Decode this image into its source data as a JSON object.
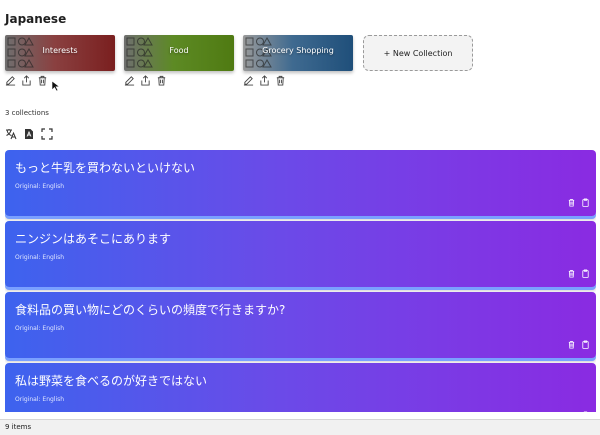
{
  "page": {
    "title": "Japanese"
  },
  "collections": [
    {
      "name": "Interests",
      "color": "#7a1f1f"
    },
    {
      "name": "Food",
      "color": "#4f7a12"
    },
    {
      "name": "Grocery Shopping",
      "color": "#1f4f7a"
    }
  ],
  "new_collection_label": "+ New Collection",
  "collections_count": "3 collections",
  "toolbar_icons": [
    "translate-icon",
    "pdf-icon",
    "fullscreen-icon"
  ],
  "phrases": [
    {
      "text": "もっと牛乳を買わないといけない",
      "original": "Original: English"
    },
    {
      "text": "ニンジンはあそこにあります",
      "original": "Original: English"
    },
    {
      "text": "食料品の買い物にどのくらいの頻度で行きますか?",
      "original": "Original: English"
    },
    {
      "text": "私は野菜を食べるのが好きではない",
      "original": "Original: English"
    }
  ],
  "status": {
    "items": "9 items"
  },
  "colors": {
    "card_gradient_start": "#3d63ee",
    "card_gradient_end": "#8a2be2"
  }
}
